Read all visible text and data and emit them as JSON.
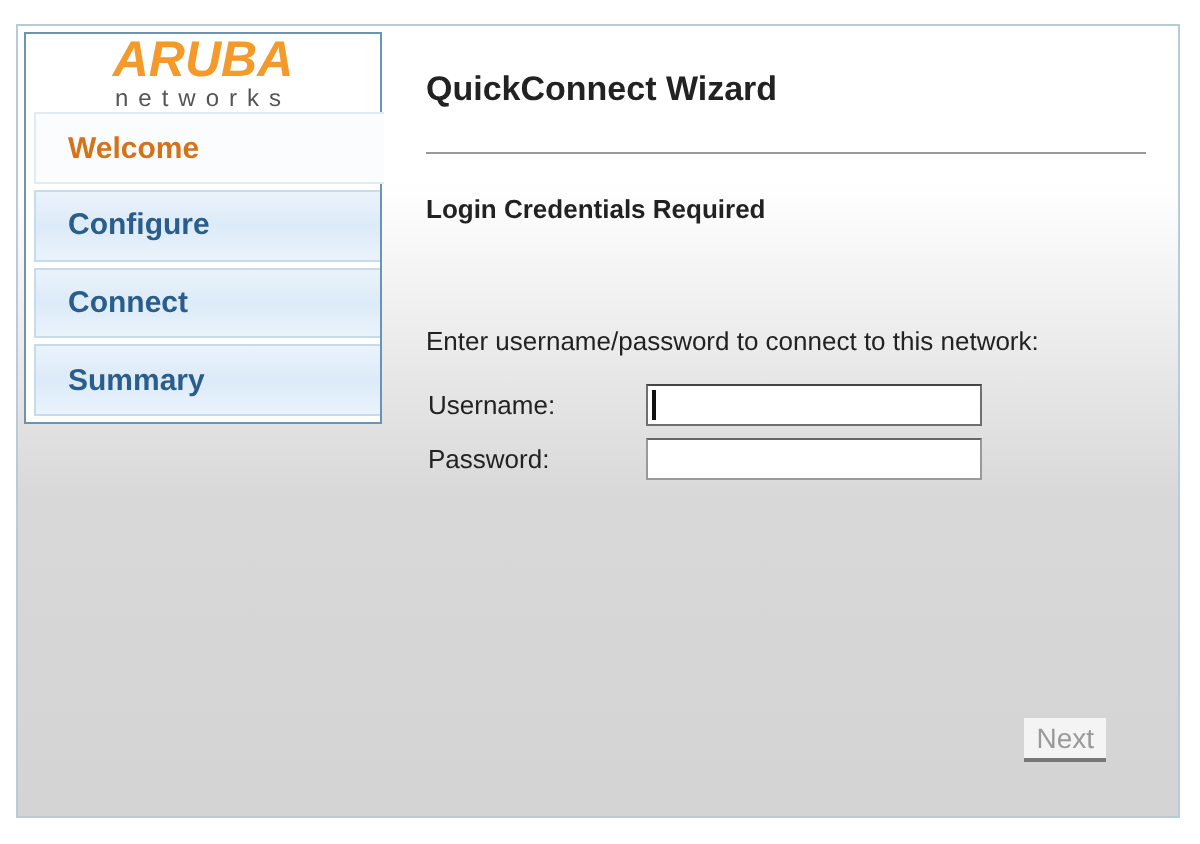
{
  "logo": {
    "brand": "ARUBA",
    "sub": "networks"
  },
  "steps": [
    {
      "label": "Welcome",
      "selected": true
    },
    {
      "label": "Configure",
      "selected": false
    },
    {
      "label": "Connect",
      "selected": false
    },
    {
      "label": "Summary",
      "selected": false
    }
  ],
  "title": "QuickConnect Wizard",
  "subtitle": "Login Credentials Required",
  "instruction": "Enter username/password to connect to this network:",
  "fields": [
    {
      "label": "Username:",
      "focused": true
    },
    {
      "label": "Password:",
      "focused": false
    }
  ],
  "next_button": {
    "label": "Next",
    "disabled": true
  }
}
